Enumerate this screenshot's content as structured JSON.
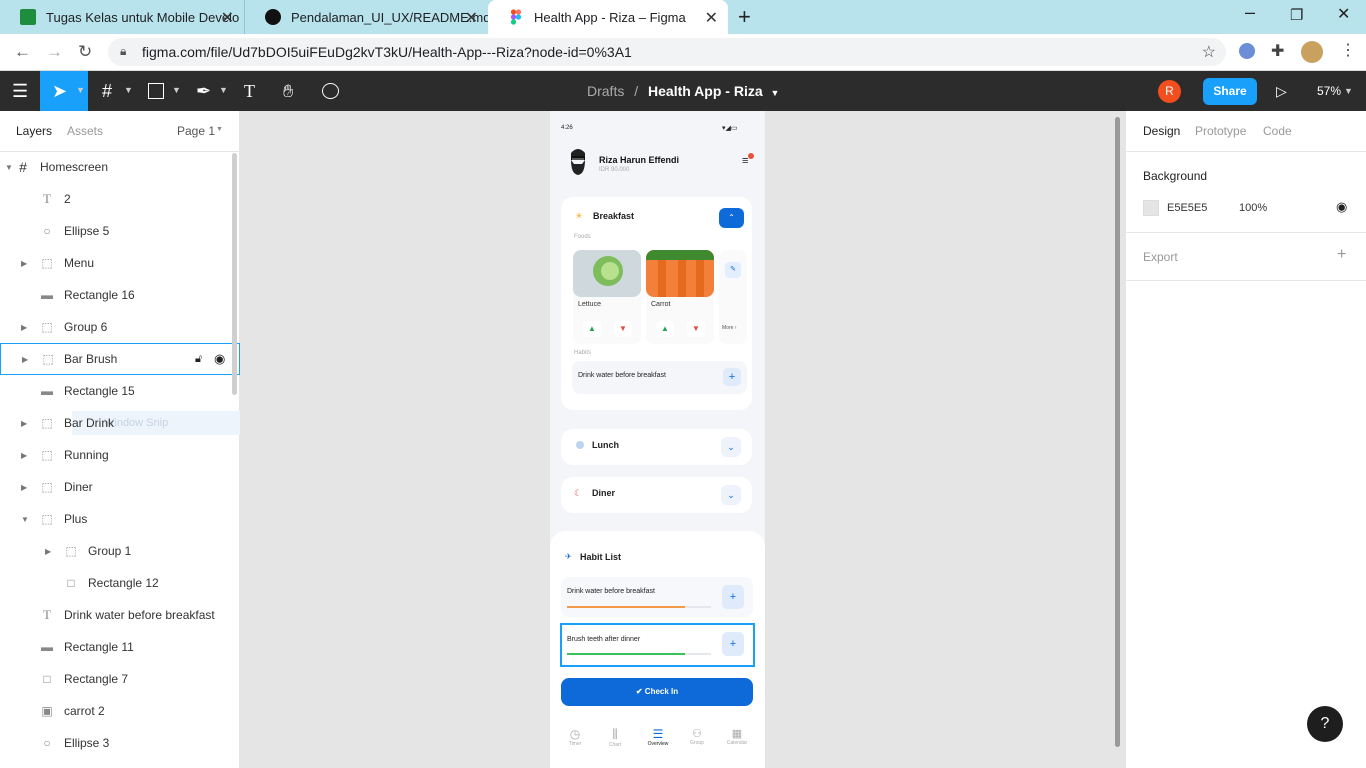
{
  "browser": {
    "tabs": [
      {
        "label": "Tugas Kelas untuk Mobile Develo",
        "icon": "classroom-icon"
      },
      {
        "label": "Pendalaman_UI_UX/README.md",
        "icon": "github-icon"
      },
      {
        "label": "Health App - Riza – Figma",
        "icon": "figma-icon"
      }
    ],
    "url": "figma.com/file/Ud7bDOI5uiFEuDg2kvT3kU/Health-App---Riza?node-id=0%3A1"
  },
  "toolbar": {
    "breadcrumb_root": "Drafts",
    "separator": "/",
    "file_title": "Health App - Riza",
    "avatar_initial": "R",
    "share_label": "Share",
    "zoom": "57%"
  },
  "left_panel": {
    "tabs": [
      "Layers",
      "Assets"
    ],
    "page": "Page 1",
    "frame": "Homescreen",
    "layers": [
      "2",
      "Ellipse 5",
      "Menu",
      "Rectangle 16",
      "Group 6",
      "Bar Brush",
      "Rectangle 15",
      "Bar Drink",
      "Running",
      "Diner",
      "Plus",
      "Group 1",
      "Rectangle 12",
      "Drink water before breakfast",
      "Rectangle 11",
      "Rectangle 7",
      "carrot 2",
      "Ellipse 3"
    ],
    "ghost_text": "Window Snip"
  },
  "right_panel": {
    "tabs": [
      "Design",
      "Prototype",
      "Code"
    ],
    "background_label": "Background",
    "bg_hex": "E5E5E5",
    "bg_opacity": "100%",
    "export_label": "Export"
  },
  "app": {
    "time": "4:26",
    "user_name": "Riza Harun Effendi",
    "balance": "IDR 90.000",
    "breakfast": "Breakfast",
    "foods_label": "Foods",
    "food1": "Lettuce",
    "food2": "Carrot",
    "more": "More ›",
    "habits_label": "Habits",
    "habit_item": "Drink water before breakfast",
    "lunch": "Lunch",
    "diner": "Diner",
    "habit_list": "Habit List",
    "habit1": "Drink water before breakfast",
    "habit1_progress": 0.82,
    "habit2": "Brush teeth after dinner",
    "habit2_progress": 0.82,
    "checkin": "Check In",
    "nav": [
      "Timer",
      "Chart",
      "Overview",
      "Group",
      "Calendar"
    ]
  },
  "colors": {
    "accent": "#0d6ad8",
    "share": "#18a0fb",
    "avatar": "#f24e1e",
    "select": "#18a0fb"
  }
}
